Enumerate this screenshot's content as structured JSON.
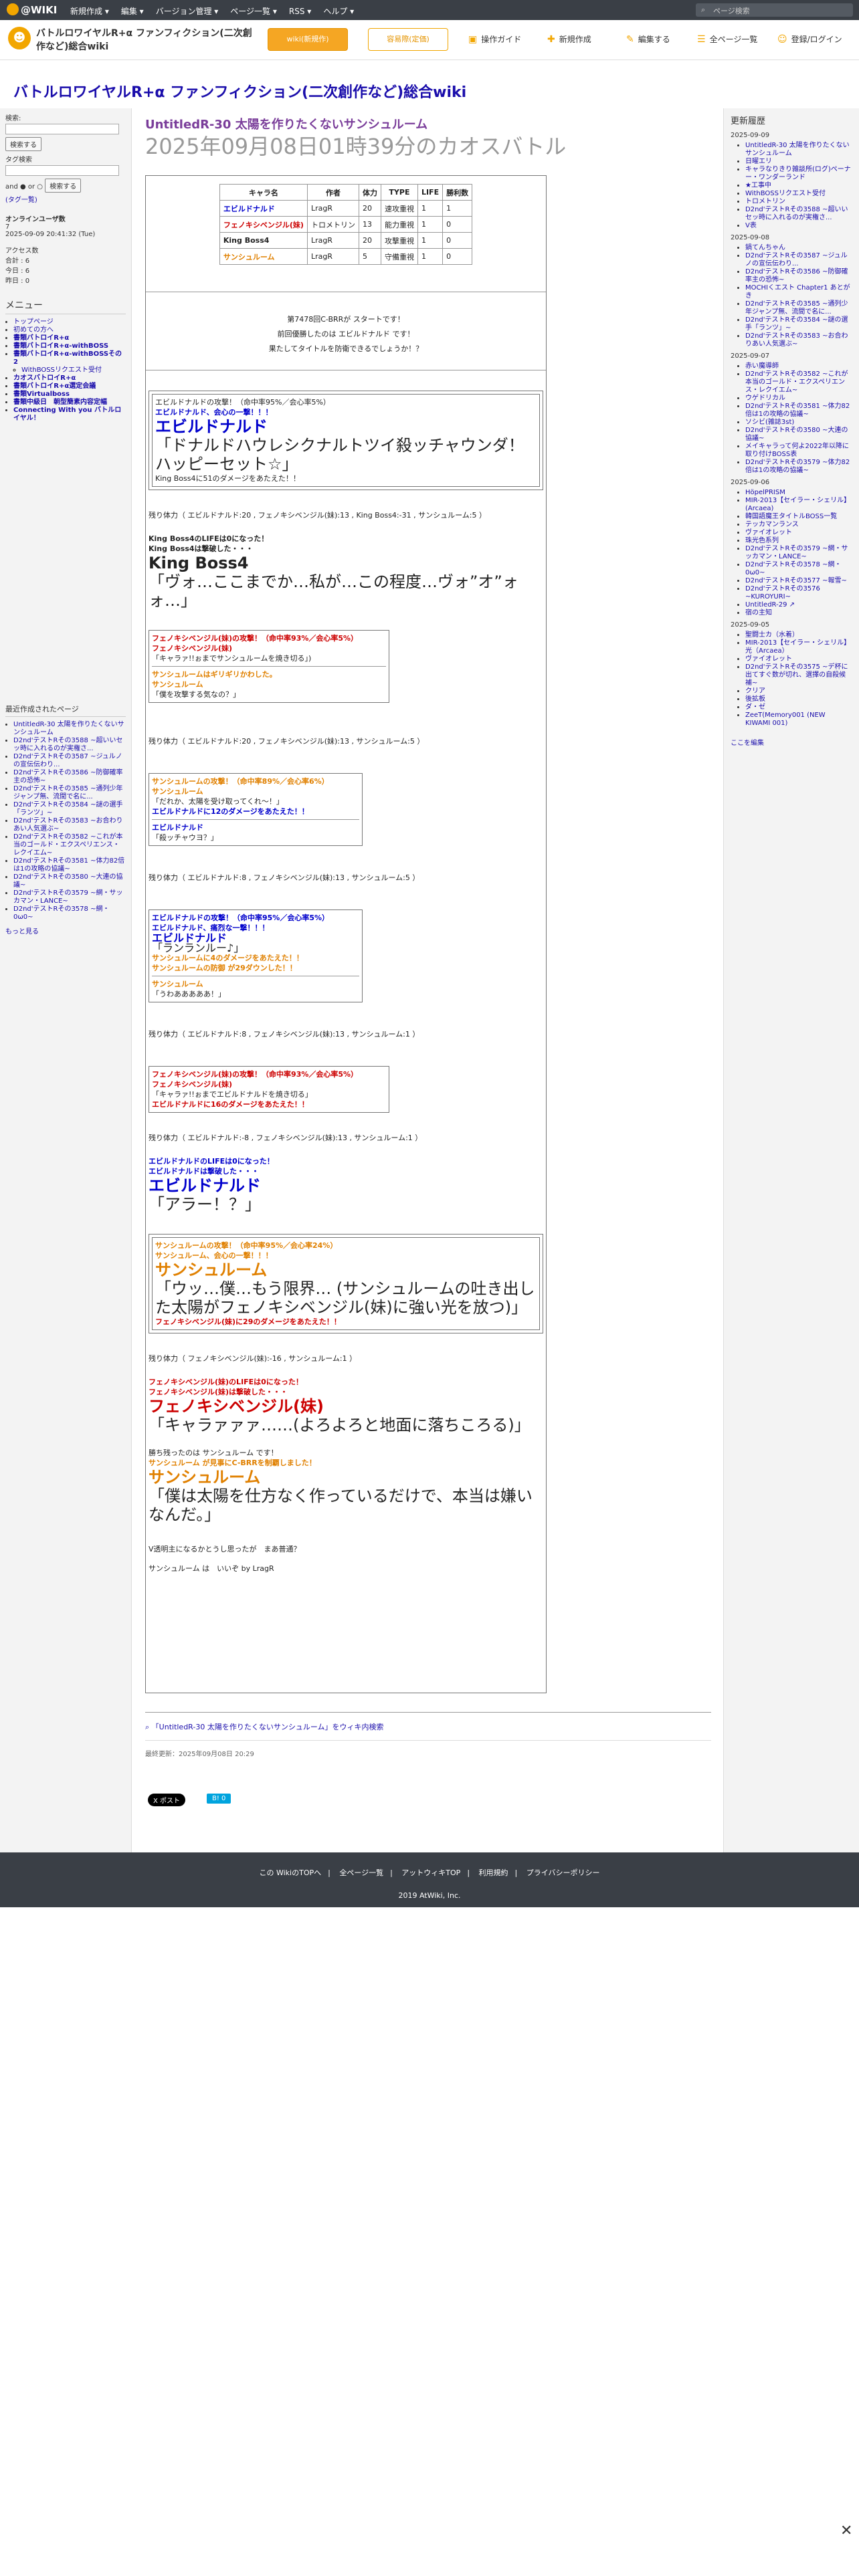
{
  "topbar": {
    "logo": "@WIKI",
    "menu": [
      "新規作成 ▾",
      "編集 ▾",
      "バージョン管理 ▾",
      "ページ一覧 ▾",
      "RSS ▾",
      "ヘルプ ▾"
    ],
    "search_placeholder": "ページ検索"
  },
  "header": {
    "site_title": "バトルロワイヤルR+α ファンフィクション(二次創作など)総合wiki",
    "btn_adfree": "wiki(新規作)",
    "btn_meeting": "容易際(定価)",
    "nav": [
      "操作ガイド",
      "新規作成",
      "編集する",
      "全ページ一覧",
      "登録/ログイン"
    ]
  },
  "banner": {
    "title": "バトルロワイヤルR+α ファンフィクション(二次創作など)総合wiki"
  },
  "left": {
    "search_label": "検索:",
    "search_btn": "検索する",
    "tag_label": "タグ検索",
    "and_or": "and ● or ○",
    "tag_btn": "検索する",
    "tag_list": "(タグ一覧)",
    "online_label": "オンラインユーザ数",
    "online_count": "7",
    "now": "2025-09-09 20:41:32 (Tue)",
    "access_label": "アクセス数",
    "access_total": "合計 : 6",
    "access_today": "今日 : 6",
    "access_yest": "昨日 : 0",
    "menu_title": "メニュー",
    "menu_items": [
      "トップページ",
      "初めての方へ",
      "書類バトロイR+α",
      "書類バトロイR+α-withBOSS",
      "書類バトロイR+α-withBOSSその2",
      "WithBOSSリクエスト受付",
      "カオスバトロイR+α",
      "書類バトロイR+α選定会議",
      "書類Virtualboss",
      "書類中級日　朝型簡素内容定幅",
      "Connecting With you バトルロイヤル！"
    ],
    "recent_title": "最近作成されたページ",
    "recent": [
      "UntitledR-30 太陽を作りたくないサンシュルーム",
      "D2nd'テストRその3588 ~超いいセッ時に入れるのが実権さ...",
      "D2nd'テストRその3587 ~ジュルノの宣伝伝わり...",
      "D2nd'テストRその3586 ~防御確率主の恐怖~",
      "D2nd'テストRその3585 ~通列少年ジャンプ無、流間で名に...",
      "D2nd'テストRその3584 ~謎の選手「ランツ」~",
      "D2nd'テストRその3583 ~お合わりあい人気選ぶ~",
      "D2nd'テストRその3582 ~これが本当のゴールド・エクスペリエンス・レクイエム~",
      "D2nd'テストRその3581 ~体力82倍は1の攻略の協議~",
      "D2nd'テストRその3580 ~大連の協議~",
      "D2nd'テストRその3579 ~網・サッカマン・LANCE~",
      "D2nd'テストRその3578 ~網・0ω0~"
    ],
    "more": "もっと見る"
  },
  "main": {
    "page_title": "UntitledR-30 太陽を作りたくないサンシュルーム",
    "subtitle": "2025年09月08日01時39分のカオスバトル",
    "table_headers": [
      "キャラ名",
      "作者",
      "体力",
      "TYPE",
      "LIFE",
      "勝利数"
    ],
    "table_rows": [
      [
        "エビルドナルド",
        "LragR",
        "20",
        "速攻重視",
        "1",
        "1"
      ],
      [
        "フェノキシベンジル(妹)",
        "トロメトリン",
        "13",
        "能力重視",
        "1",
        "0"
      ],
      [
        "King Boss4",
        "LragR",
        "20",
        "攻撃重視",
        "1",
        "0"
      ],
      [
        "サンシュルーム",
        "LragR",
        "5",
        "守備重視",
        "1",
        "0"
      ]
    ],
    "intro": [
      "第7478回C-BRRが スタートです！",
      "前回優勝したのは エビルドナルド です！",
      "果たしてタイトルを防衛できるでしょうか！？"
    ],
    "log": [
      {
        "a": "エビルドナルドの攻撃！（命中率95%／会心率5%）",
        "b": "エビルドナルド、会心の一撃！！！",
        "big1": "エビルドナルド",
        "big2": "「ドナルドハウレシクナルトツイ殺ッチャウンダ！ハッピーセット☆」",
        "c": "King Boss4に51のダメージをあたえた！！"
      },
      {
        "rest": "残り体力（ エビルドナルド:20 , フェノキシベンジル(妹):13 , King Boss4:-31 , サンシュルーム:5 ）"
      },
      {
        "a": "King Boss4のLIFEは0になった！",
        "b": "King Boss4は撃破した・・・",
        "big1": "King Boss4",
        "big2": "「ヴォ…ここまでか…私が…この程度…ヴォ”オ”ォォ…」"
      }
    ],
    "b2": {
      "a": "フェノキシベンジル(妹)の攻撃！（命中率93%／会心率5%）",
      "b": "フェノキシベンジル(妹)",
      "c": "「キャラァ!!ぉまでサンシュルームを焼き切る」)",
      "d": "サンシュルームはギリギリかわした。",
      "e": "サンシュルーム",
      "f": "「僕を攻撃する気なの？」"
    },
    "rest2": "残り体力（ エビルドナルド:20 , フェノキシベンジル(妹):13 , サンシュルーム:5 ）",
    "b3": {
      "a": "サンシュルームの攻撃！（命中率89%／会心率6%）",
      "b": "サンシュルーム",
      "c": "「だれか、太陽を受け取ってくれ〜！」",
      "d": "エビルドナルドに12のダメージをあたえた！！",
      "e": "エビルドナルド",
      "f": "「殺ッチャウヨ？」"
    },
    "rest3": "残り体力（ エビルドナルド:8 , フェノキシベンジル(妹):13 , サンシュルーム:5 ）",
    "b4": {
      "a": "エビルドナルドの攻撃！（命中率95%／会心率5%）",
      "b": "エビルドナルド、痛烈な一撃！！！",
      "big1": "エビルドナルド",
      "big2": "「ランランルー♪」",
      "c": "サンシュルームに4のダメージをあたえた！！",
      "d": "サンシュルームの防御 が29ダウンした！！",
      "e": "サンシュルーム",
      "f": "「うわあああああ！」"
    },
    "rest4": "残り体力（ エビルドナルド:8 , フェノキシベンジル(妹):13 , サンシュルーム:1 ）",
    "b5": {
      "a": "フェノキシベンジル(妹)の攻撃！（命中率93%／会心率5%）",
      "b": "フェノキシベンジル(妹)",
      "c": "「キャラァ!!ぉまでエビルドナルドを焼き切る」",
      "d": "エビルドナルドに16のダメージをあたえた！！"
    },
    "rest5": "残り体力（ エビルドナルド:-8 , フェノキシベンジル(妹):13 , サンシュルーム:1 ）",
    "b6": {
      "a": "エビルドナルドのLIFEは0になった！",
      "b": "エビルドナルドは撃破した・・・",
      "big1": "エビルドナルド",
      "big2": "「アラー！？」"
    },
    "b7": {
      "a": "サンシュルームの攻撃！（命中率95%／会心率24%）",
      "b": "サンシュルーム、会心の一撃！！！",
      "big1": "サンシュルーム",
      "big2": "「ウッ…僕…もう限界… (サンシュルームの吐き出した太陽がフェノキシベンジル(妹)に強い光を放つ)」",
      "c": "フェノキシベンジル(妹)に29のダメージをあたえた！！"
    },
    "rest6": "残り体力（ フェノキシベンジル(妹):-16 , サンシュルーム:1 ）",
    "b8": {
      "a": "フェノキシベンジル(妹)のLIFEは0になった！",
      "b": "フェノキシベンジル(妹)は撃破した・・・",
      "big1": "フェノキシベンジル(妹)",
      "big2": "「キャラァァァ……(よろよろと地面に落ちころる)」"
    },
    "end": {
      "a": "勝ち残ったのは サンシュルーム です！",
      "b": "サンシュルーム が見事にC-BRRを制覇しました！",
      "big1": "サンシュルーム",
      "big2": "「僕は太陽を仕方なく作っているだけで、本当は嫌いなんだ。」",
      "c": "V透明主になるかとうし思ったが　まあ普通？",
      "d": "サンシュルーム は　いいぞ by LragR"
    },
    "search_wiki": "「UntitledR-30 太陽を作りたくないサンシュルーム」をウィキ内検索",
    "last_update": "最終更新：2025年09月08日 20:29",
    "share1": "X ポスト",
    "share2": "B! 0"
  },
  "right": {
    "title": "更新履歴",
    "groups": [
      {
        "date": "2025-09-09",
        "items": [
          "UntitledR-30 太陽を作りたくないサンシュルーム",
          "日曜エリ",
          "キャラなりきり雑談所(ログ)ペーナー・ワンダーランド",
          "★工事中",
          "WithBOSSリクエスト受付",
          "トロメトリン",
          "D2nd'テストRその3588 ~超いいセッ時に入れるのが実権さ...",
          "V表"
        ]
      },
      {
        "date": "2025-09-08",
        "items": [
          "鍋てんちゃん",
          "D2nd'テストRその3587 ~ジュルノの宣伝伝わり...",
          "D2nd'テストRその3586 ~防御確率主の恐怖~",
          "MOCHIくエスト Chapter1 あとがき",
          "D2nd'テストRその3585 ~通列少年ジャンプ無、流間で名に...",
          "D2nd'テストRその3584 ~謎の選手「ランツ」~",
          "D2nd'テストRその3583 ~お合わりあい人気選ぶ~"
        ]
      },
      {
        "date": "2025-09-07",
        "items": [
          "赤い魔導師",
          "D2nd'テストRその3582 ~これが本当のゴールド・エクスペリエンス・レクイエム~",
          "ウゲドリカル",
          "D2nd'テストRその3581 ~体力82倍は1の攻略の協議~",
          "ソシビ(雑誌3st)",
          "D2nd'テストRその3580 ~大連の協議~",
          "メイキャラって何よ2022年以降に取り付けBOSS表",
          "D2nd'テストRその3579 ~体力82倍は1の攻略の協議~"
        ]
      },
      {
        "date": "2025-09-06",
        "items": [
          "HöpelPRISM",
          "MIR-2013【セイラー・シェリル】(Arcaea)",
          "韓国語魔王タイトルBOSS一覧",
          "テッカマンランス",
          "ヴァイオレット",
          "珠光色系列",
          "D2nd'テストRその3579 ~網・サッカマン・LANCE~",
          "D2nd'テストRその3578 ~網・0ω0~",
          "D2nd'テストRその3577 ~報雪~",
          "D2nd'テストRその3576 ~KUROYURI~",
          "UntitledR-29 ↗",
          "宿の主知"
        ]
      },
      {
        "date": "2025-09-05",
        "items": [
          "聖闘士カ（水着）",
          "MIR-2013【セイラー・シェリル】光（Arcaea）",
          "ヴァイオレット",
          "D2nd'テストRその3575 ~デ杯に出てすぐ数が切れ、選擇の自殺候補~",
          "クリア",
          "後拡板",
          "ダ・ゼ",
          "ZeeT(Memory001 (NEW KIWAMI 001)"
        ]
      }
    ],
    "more": "ここを編集"
  },
  "footer": {
    "links": [
      "この WikiのTOPへ",
      "全ページ一覧",
      "アットウィキTOP",
      "利用規約",
      "プライバシーポリシー"
    ],
    "copy": "2019 AtWiki, Inc."
  },
  "close_symbol": "✕"
}
